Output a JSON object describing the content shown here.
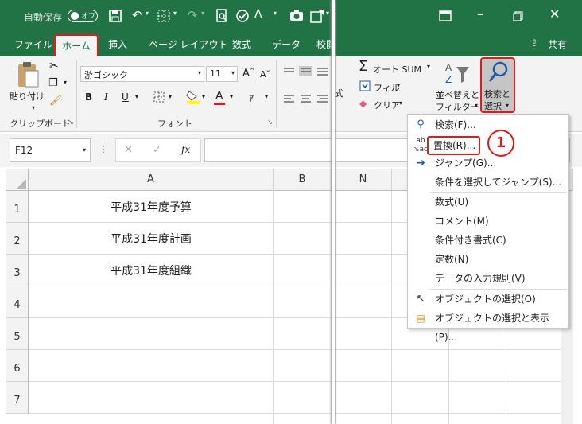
{
  "qat": {
    "autosave_label": "自動保存",
    "autosave_state": "オフ"
  },
  "tabs": {
    "file": "ファイル",
    "home": "ホーム",
    "insert": "挿入",
    "page_layout": "ページ レイアウト",
    "formulas": "数式",
    "data": "データ",
    "review_partial": "校閲",
    "share": "共有"
  },
  "ribbon": {
    "paste_label": "貼り付け",
    "clipboard_group": "クリップボード",
    "font_name": "游ゴシック",
    "font_size": "11",
    "bold": "B",
    "italic": "I",
    "underline": "U",
    "font_group": "フォント",
    "autosum": "オート SUM",
    "fill": "フィル",
    "clear": "クリア",
    "sort_filter_line1": "並べ替えと",
    "sort_filter_line2": "フィルター",
    "find_select_line1": "検索と",
    "find_select_line2": "選択",
    "partial_style": "式"
  },
  "formula_bar": {
    "name_box": "F12",
    "fx": "fx",
    "value": ""
  },
  "grid": {
    "columns_left": [
      "A",
      "B"
    ],
    "columns_right": [
      "N"
    ],
    "rows": [
      "1",
      "2",
      "3",
      "4",
      "5",
      "6",
      "7"
    ],
    "cells": [
      "平成31年度予算",
      "平成31年度計画",
      "平成31年度組織"
    ]
  },
  "menu": {
    "items": [
      "検索(F)...",
      "置換(R)...",
      "ジャンプ(G)...",
      "条件を選択してジャンプ(S)...",
      "数式(U)",
      "コメント(M)",
      "条件付き書式(C)",
      "定数(N)",
      "データの入力規則(V)",
      "オブジェクトの選択(O)",
      "オブジェクトの選択と表示(P)..."
    ]
  },
  "annotation": {
    "step": "1"
  },
  "colors": {
    "excel_green": "#217346",
    "highlight_red": "#e01b1b"
  }
}
